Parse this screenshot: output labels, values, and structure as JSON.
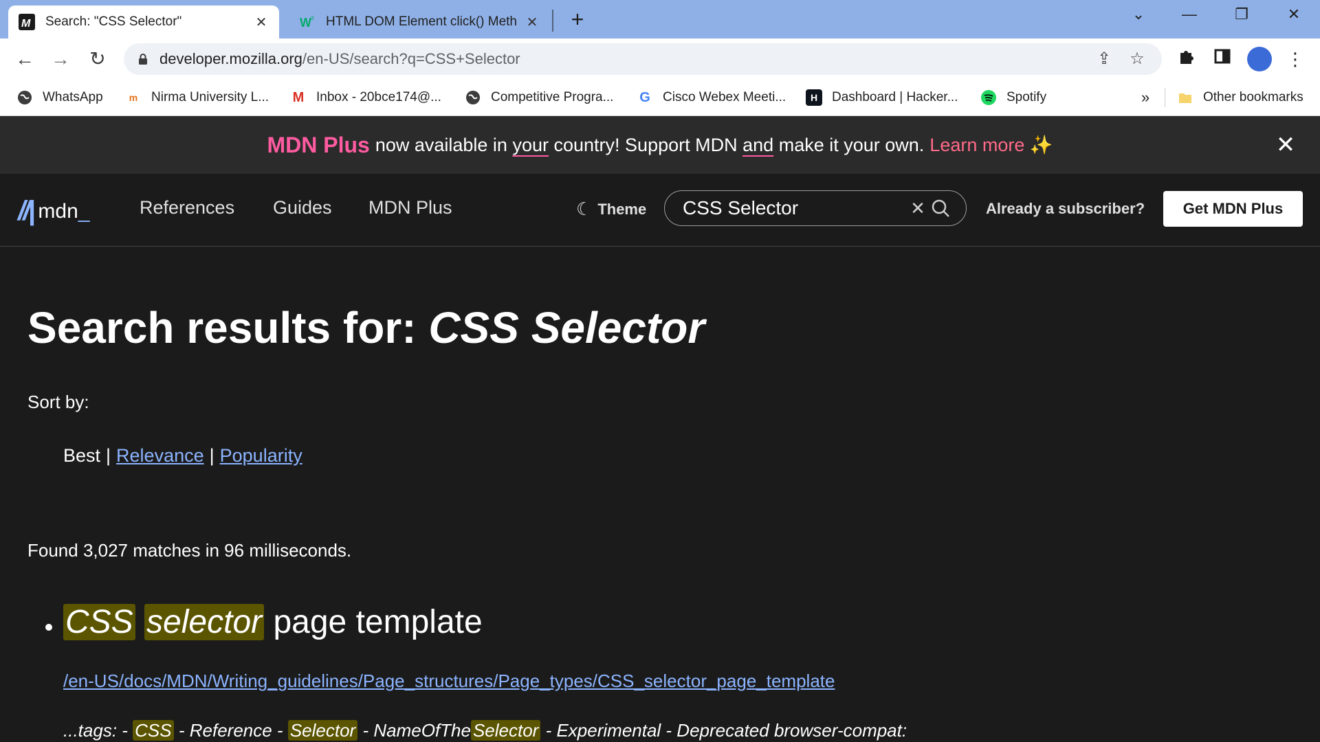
{
  "browser": {
    "tabs": [
      {
        "title": "Search: \"CSS Selector\"",
        "favicon": "mdn-icon",
        "active": true
      },
      {
        "title": "HTML DOM Element click() Meth",
        "favicon": "w3schools-icon",
        "active": false
      }
    ],
    "url_host": "developer.mozilla.org",
    "url_path": "/en-US/search?q=CSS+Selector",
    "bookmarks": [
      {
        "label": "WhatsApp",
        "icon": "globe-icon"
      },
      {
        "label": "Nirma University L...",
        "icon": "nirma-icon"
      },
      {
        "label": "Inbox - 20bce174@...",
        "icon": "gmail-icon"
      },
      {
        "label": "Competitive Progra...",
        "icon": "globe-icon"
      },
      {
        "label": "Cisco Webex Meeti...",
        "icon": "google-icon"
      },
      {
        "label": "Dashboard | Hacker...",
        "icon": "hackerrank-icon"
      },
      {
        "label": "Spotify",
        "icon": "spotify-icon"
      }
    ],
    "overflow_label": "»",
    "other_bookmarks": "Other bookmarks"
  },
  "banner": {
    "brand": "MDN Plus",
    "text_1": "now available in",
    "text_your": "your",
    "text_2": "country! Support MDN",
    "text_and": "and",
    "text_3": "make it your own.",
    "learn_more": "Learn more",
    "sparkle": "✨"
  },
  "header": {
    "logo_text": "mdn",
    "nav": [
      "References",
      "Guides",
      "MDN Plus"
    ],
    "theme_label": "Theme",
    "search_value": "CSS Selector",
    "subscriber_label": "Already a subscriber?",
    "get_plus_label": "Get MDN Plus"
  },
  "main": {
    "title_prefix": "Search results for:",
    "title_query": "CSS Selector",
    "sort_label": "Sort by:",
    "sort_best": "Best",
    "sort_relevance": "Relevance",
    "sort_popularity": "Popularity",
    "found_text": "Found 3,027 matches in 96 milliseconds.",
    "results": [
      {
        "title_hl_1": "CSS",
        "title_hl_2": "selector",
        "title_rest": "page template",
        "url": "/en-US/docs/MDN/Writing_guidelines/Page_structures/Page_types/CSS_selector_page_template",
        "snippet_1": "...tags: -",
        "snippet_hl_1": "CSS",
        "snippet_2": "- Reference -",
        "snippet_hl_2": "Selector",
        "snippet_3": "- NameOfThe",
        "snippet_hl_3": "Selector",
        "snippet_4": "- Experimental - Deprecated browser-compat:"
      }
    ]
  },
  "colors": {
    "accent_link": "#8cb4ff",
    "plus_pink": "#ff5ba1",
    "highlight": "#5b5500",
    "background": "#1b1b1b"
  }
}
